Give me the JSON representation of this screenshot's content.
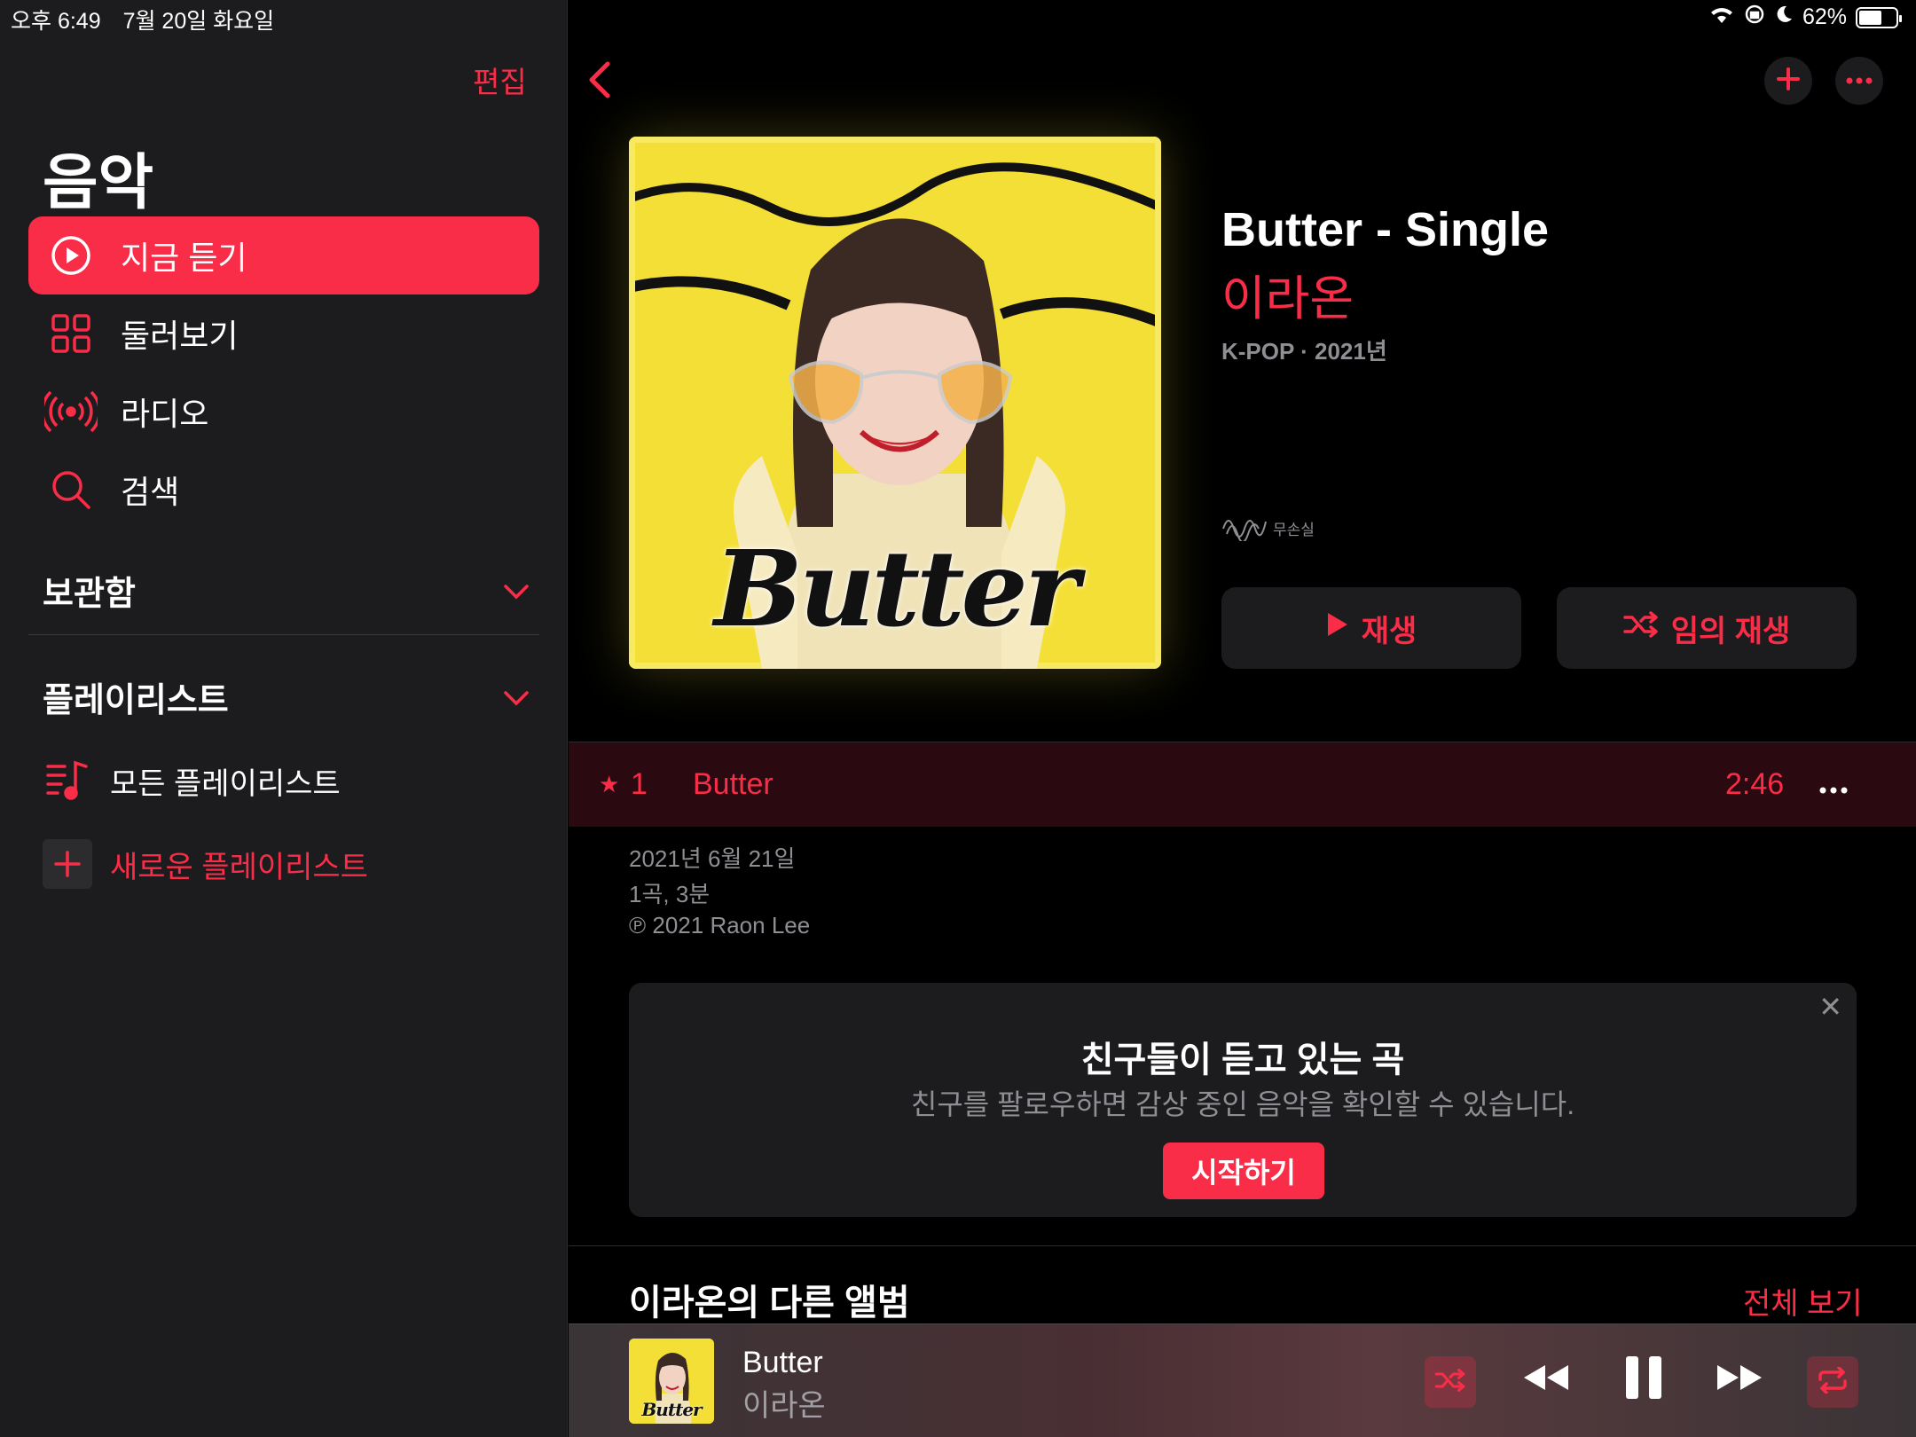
{
  "status_bar": {
    "time": "오후 6:49",
    "date": "7월 20일 화요일",
    "battery": "62%"
  },
  "sidebar": {
    "edit_label": "편집",
    "title": "음악",
    "nav": [
      {
        "label": "지금 듣기",
        "icon": "play-circle-icon",
        "active": true
      },
      {
        "label": "둘러보기",
        "icon": "grid-icon"
      },
      {
        "label": "라디오",
        "icon": "radio-icon"
      },
      {
        "label": "검색",
        "icon": "search-icon"
      }
    ],
    "library_label": "보관함",
    "playlists_label": "플레이리스트",
    "all_playlists_label": "모든 플레이리스트",
    "new_playlist_label": "새로운 플레이리스트"
  },
  "album": {
    "title": "Butter - Single",
    "artist": "이라온",
    "meta": "K-POP · 2021년",
    "lossless_label": "무손실",
    "cover_text": "Butter",
    "play_label": "재생",
    "shuffle_label": "임의 재생"
  },
  "tracks": [
    {
      "number": "1",
      "title": "Butter",
      "duration": "2:46"
    }
  ],
  "release_info": {
    "date": "2021년 6월 21일",
    "count": "1곡, 3분",
    "copyright": "℗ 2021 Raon Lee"
  },
  "friends_card": {
    "title": "친구들이 듣고 있는 곡",
    "subtitle": "친구를 팔로우하면 감상 중인 음악을 확인할 수 있습니다.",
    "button": "시작하기"
  },
  "other_albums": {
    "title": "이라온의 다른 앨범",
    "see_all": "전체 보기"
  },
  "now_playing": {
    "title": "Butter",
    "artist": "이라온",
    "cover_text": "Butter"
  },
  "colors": {
    "accent": "#fa2d48",
    "sidebar_bg": "#1c1c1e",
    "bg": "#000000"
  }
}
